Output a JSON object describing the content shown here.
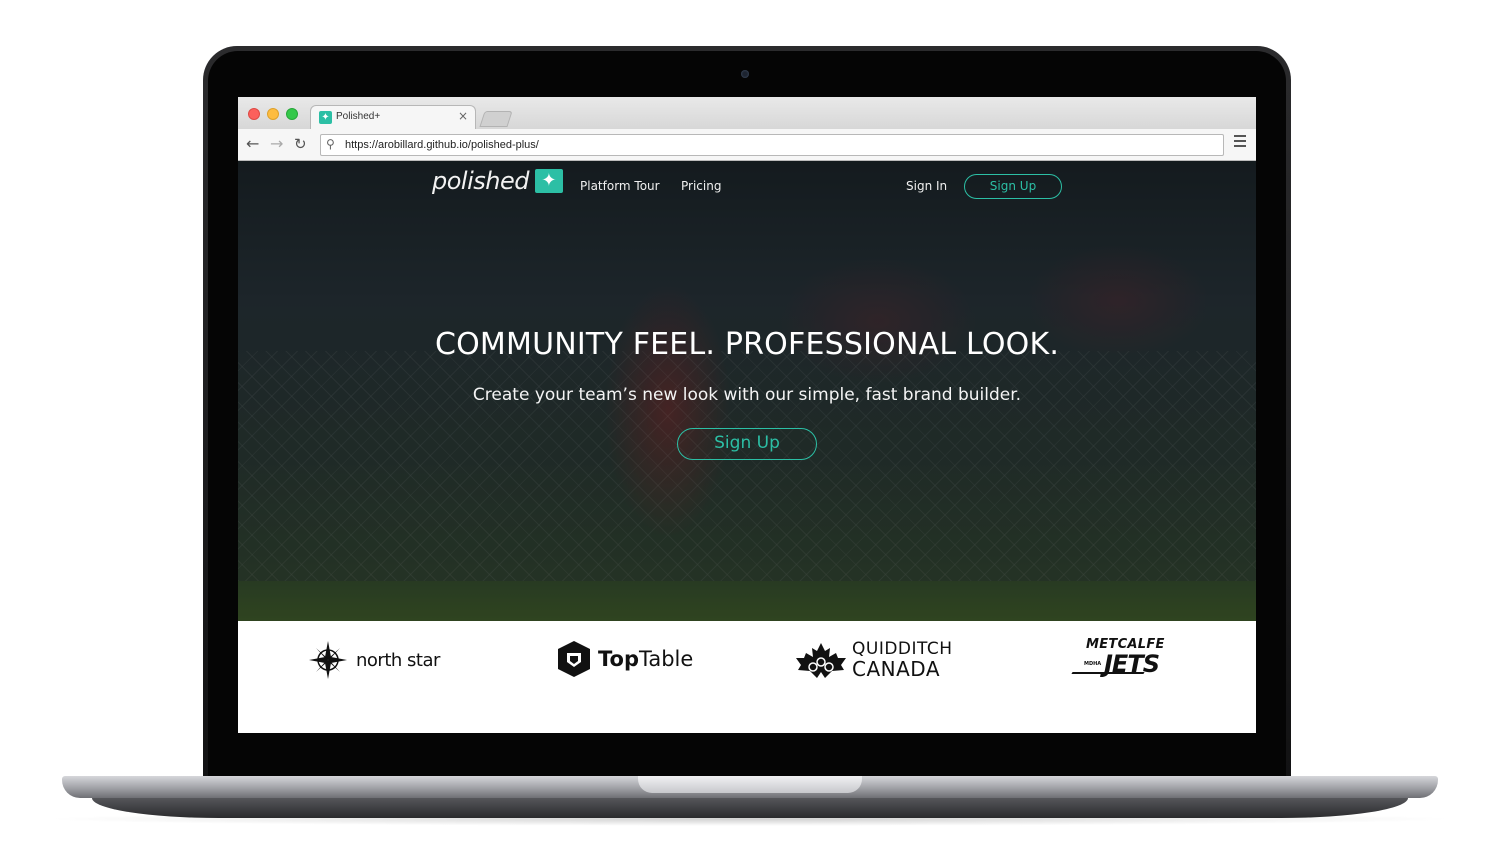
{
  "browser": {
    "tab_title": "Polished+",
    "tab_close": "×",
    "url": "https://arobillard.github.io/polished-plus/",
    "icons": [
      "back-arrow-icon",
      "forward-arrow-icon",
      "reload-icon",
      "search-icon",
      "hamburger-menu-icon",
      "close-icon"
    ]
  },
  "site": {
    "logo_text": "polished",
    "logo_mark": "✦",
    "nav": {
      "platform_tour": "Platform Tour",
      "pricing": "Pricing",
      "sign_in": "Sign In",
      "sign_up": "Sign Up"
    },
    "hero": {
      "title": "COMMUNITY FEEL. PROFESSIONAL LOOK.",
      "subtitle": "Create your team’s new look with our simple, fast brand builder.",
      "cta": "Sign Up"
    },
    "accent_color": "#2cbfa5",
    "logos": {
      "northstar": "north star",
      "toptable_bold": "Top",
      "toptable_rest": "Table",
      "quidditch_top": "QUIDDITCH",
      "quidditch_bottom": "CANADA",
      "metcalfe_top": "METCALFE",
      "metcalfe_bottom": "JETS",
      "metcalfe_small": "MDHA"
    }
  }
}
